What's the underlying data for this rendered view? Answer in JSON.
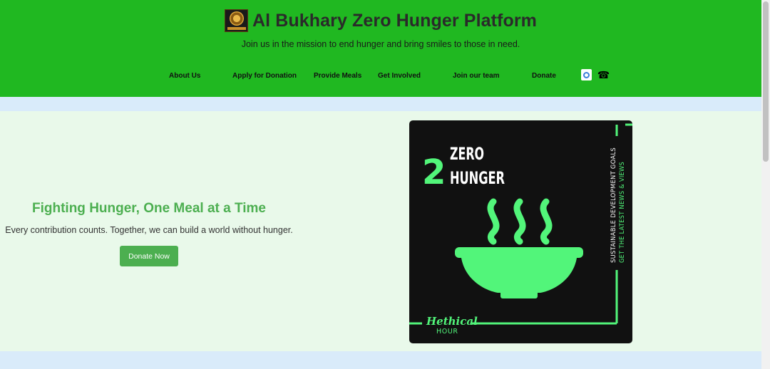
{
  "header": {
    "title": "Al Bukhary Zero Hunger Platform",
    "tagline": "Join us in the mission to end hunger and bring smiles to those in need.",
    "bg_color": "#20b821"
  },
  "nav": {
    "items": [
      {
        "label": "About Us"
      },
      {
        "label": "Apply for Donation"
      },
      {
        "label": "Provide Meals"
      },
      {
        "label": "Get Involved"
      },
      {
        "label": "Join our team"
      },
      {
        "label": "Donate"
      }
    ],
    "icons": [
      "mail-icon",
      "phone-icon"
    ]
  },
  "hero": {
    "title": "Fighting Hunger, One Meal at a Time",
    "subtitle": "Every contribution counts. Together, we can build a world without hunger.",
    "button_label": "Donate Now",
    "accent_color": "#4caf50",
    "bg_color": "#e9f9ea"
  },
  "poster": {
    "number": "2",
    "line1": "ZERO",
    "line2": "HUNGER",
    "side_text_1": "SUSTAINABLE DEVELOPMENT GOALS",
    "side_text_2": "GET THE LATEST NEWS & VIEWS",
    "brand_script": "Hethical",
    "brand_word": "HOUR",
    "accent_color": "#52f57a"
  }
}
